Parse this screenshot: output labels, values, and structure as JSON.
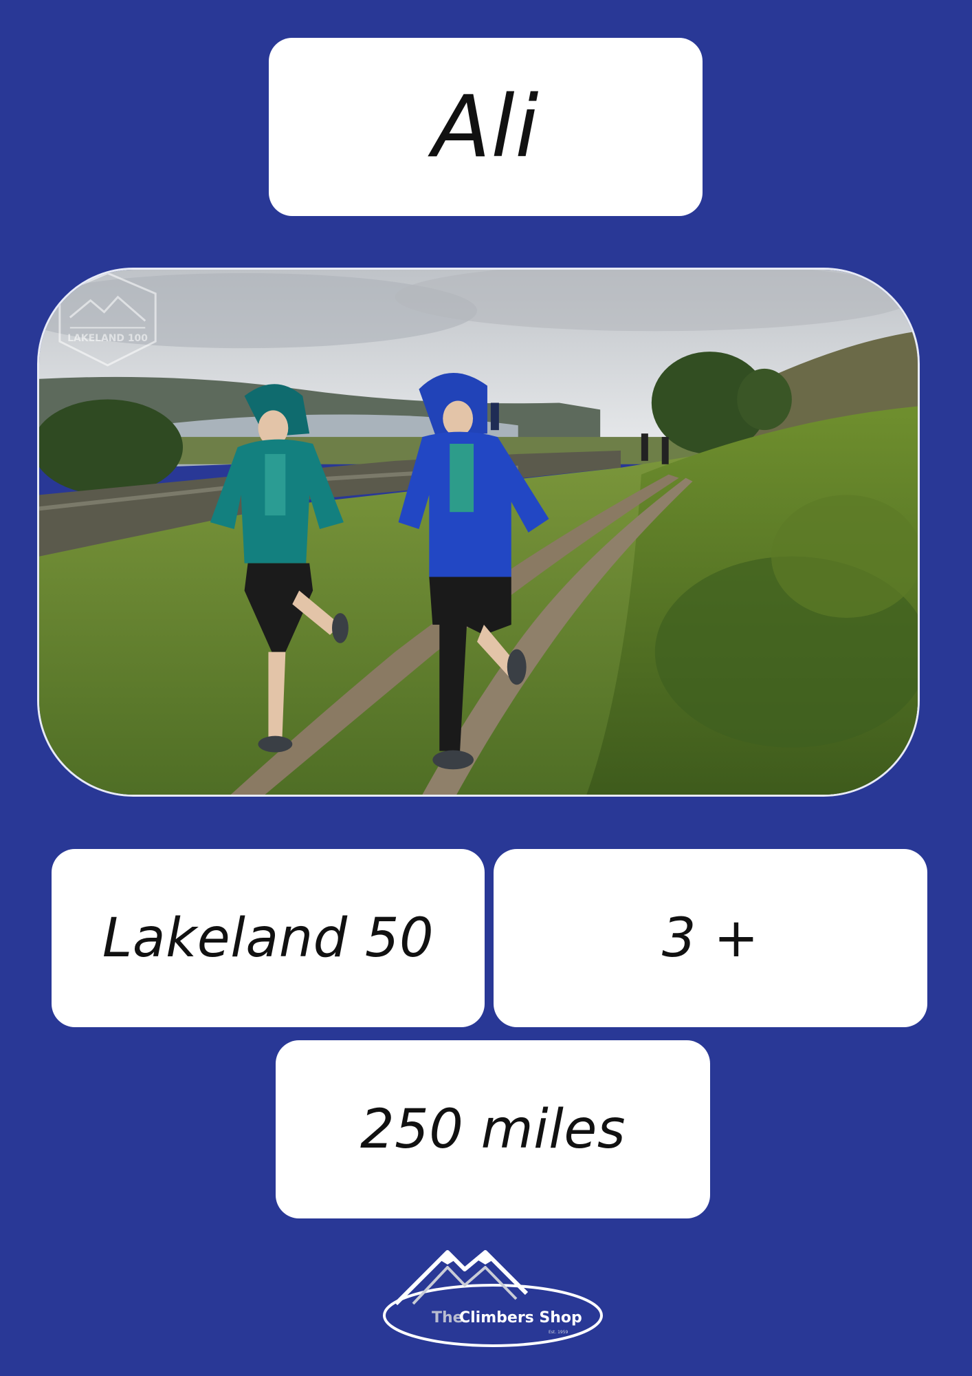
{
  "profile": {
    "name": "Ali"
  },
  "stats": {
    "event": "Lakeland 50",
    "count": "3 +",
    "distance": "250 miles"
  },
  "photo": {
    "watermark_text": "LAKELAND 100"
  },
  "logo": {
    "text_the": "The",
    "text_brand": "Climbers Shop",
    "text_est": "Est. 1959"
  },
  "colors": {
    "background": "#293896",
    "card": "#ffffff",
    "text": "#111111"
  }
}
